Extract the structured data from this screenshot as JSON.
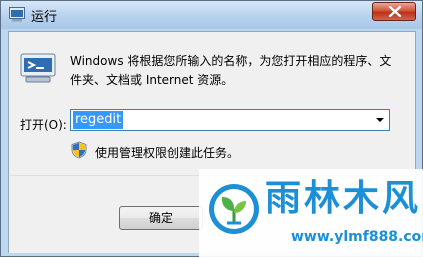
{
  "window": {
    "title": "运行",
    "close_icon": "close-icon"
  },
  "dialog": {
    "description": "Windows 将根据您所输入的名称，为您打开相应的程序、文件夹、文档或 Internet 资源。",
    "open_label": "打开(O):",
    "command_value": "regedit",
    "admin_note": "使用管理权限创建此任务。",
    "ok_label": "确定"
  },
  "watermark": {
    "title": "雨林木风",
    "url": "www.ylmf888.com"
  },
  "colors": {
    "titlebar": "#b7d2ee",
    "selection": "#3399ff",
    "watermark_blue": "#1c8fd6",
    "close_red": "#c4432a"
  }
}
